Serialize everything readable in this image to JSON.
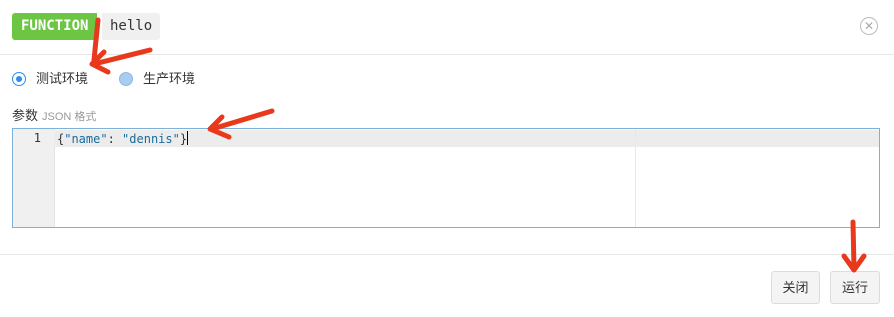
{
  "header": {
    "badge": "FUNCTION",
    "function_name": "hello",
    "close_icon": "close-circle-icon",
    "close_glyph": "✕"
  },
  "environment": {
    "options": [
      {
        "label": "测试环境",
        "checked": true
      },
      {
        "label": "生产环境",
        "checked": false
      }
    ]
  },
  "params": {
    "label": "参数",
    "hint": "JSON 格式"
  },
  "editor": {
    "line_number": "1",
    "open_brace": "{",
    "key": "\"name\"",
    "sep": ": ",
    "value": "\"dennis\"",
    "close_brace": "}"
  },
  "footer": {
    "close_label": "关闭",
    "run_label": "运行"
  },
  "annotations": {
    "arrow_color": "#e8391d",
    "count": 4
  },
  "colors": {
    "badge_bg": "#6cc644",
    "accent": "#2d8cf0"
  }
}
